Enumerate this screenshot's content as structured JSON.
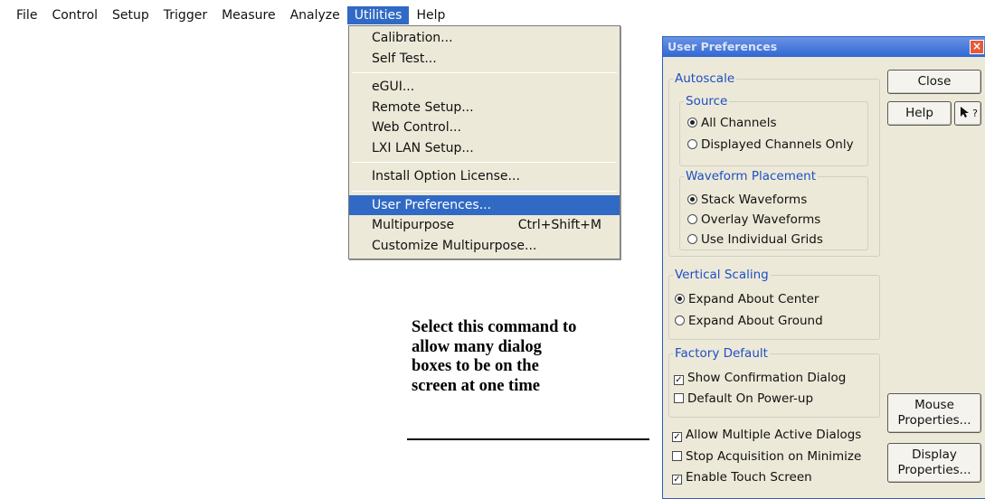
{
  "menubar": {
    "items": [
      "File",
      "Control",
      "Setup",
      "Trigger",
      "Measure",
      "Analyze",
      "Utilities",
      "Help"
    ]
  },
  "utilities_menu": {
    "items": [
      {
        "label": "Calibration..."
      },
      {
        "label": "Self Test..."
      },
      {
        "label": "eGUI..."
      },
      {
        "label": "Remote Setup..."
      },
      {
        "label": "Web Control..."
      },
      {
        "label": "LXI LAN Setup..."
      },
      {
        "label": "Install Option License..."
      },
      {
        "label": "User Preferences..."
      },
      {
        "label": "Multipurpose",
        "shortcut": "Ctrl+Shift+M"
      },
      {
        "label": "Customize Multipurpose..."
      }
    ]
  },
  "callout": {
    "lines": [
      "Select this command to",
      "allow many dialog",
      "boxes to be on the",
      "screen at one time"
    ]
  },
  "dialog": {
    "title": "User Preferences",
    "autoscale": {
      "label": "Autoscale",
      "source": {
        "label": "Source",
        "options": [
          "All Channels",
          "Displayed Channels Only"
        ],
        "selected": "All Channels"
      },
      "placement": {
        "label": "Waveform Placement",
        "options": [
          "Stack Waveforms",
          "Overlay Waveforms",
          "Use Individual Grids"
        ],
        "selected": "Stack Waveforms"
      }
    },
    "vertical_scaling": {
      "label": "Vertical Scaling",
      "options": [
        "Expand About Center",
        "Expand About Ground"
      ],
      "selected": "Expand About Center"
    },
    "factory_default": {
      "label": "Factory Default",
      "show_confirmation": {
        "label": "Show Confirmation Dialog",
        "checked": true
      },
      "default_on_powerup": {
        "label": "Default On Power-up",
        "checked": false
      }
    },
    "allow_multiple": {
      "label": "Allow Multiple Active Dialogs",
      "checked": true
    },
    "stop_acquisition": {
      "label": "Stop Acquisition on Minimize",
      "checked": false
    },
    "touch_screen": {
      "label": "Enable Touch Screen",
      "checked": true
    },
    "buttons": {
      "close": "Close",
      "help": "Help",
      "mouse_line1": "Mouse",
      "mouse_line2": "Properties...",
      "display_line1": "Display",
      "display_line2": "Properties..."
    },
    "check_mark": "✓",
    "close_glyph": "×",
    "whats_this_glyph": "?"
  }
}
